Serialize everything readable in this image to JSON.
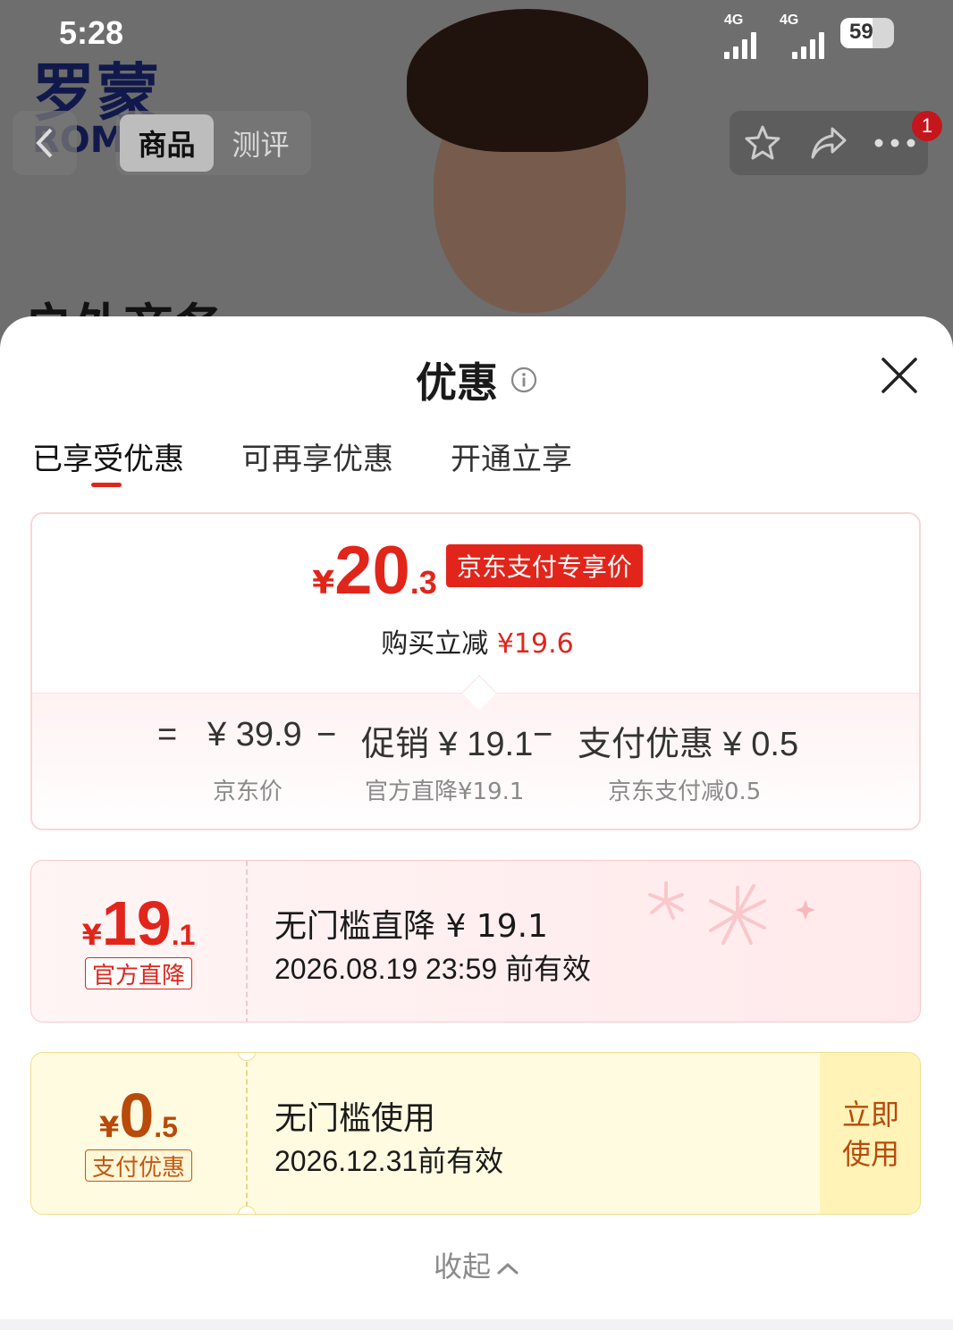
{
  "status": {
    "time": "5:28",
    "net1": "4G",
    "net2": "4G",
    "battery": "59"
  },
  "background": {
    "brand": "罗蒙",
    "brand_en": "ROM",
    "heading": "户外商务",
    "nav": {
      "tab_goods": "商品",
      "tab_review": "测评",
      "badge": "1"
    }
  },
  "sheet": {
    "title": "优惠",
    "tabs": [
      "已享受优惠",
      "可再享优惠",
      "开通立享"
    ],
    "summary": {
      "currency": "¥",
      "price_int": "20",
      "price_dec": ".3",
      "tag": "京东支付专享价",
      "reduce_label": "购买立减",
      "reduce_amount": "¥19.6",
      "formula": {
        "eq": "=",
        "base": "¥ 39.9",
        "minus1": "−",
        "promo": "促销 ¥ 19.1",
        "minus2": "−",
        "pay": "支付优惠 ¥ 0.5"
      },
      "labels": {
        "base": "京东价",
        "promo": "官方直降¥19.1",
        "pay": "京东支付减0.5"
      }
    },
    "coupons": [
      {
        "currency": "¥",
        "int": "19",
        "dec": ".1",
        "tag": "官方直降",
        "title": "无门槛直降 ¥ 19.1",
        "valid": "2026.08.19 23:59 前有效"
      },
      {
        "currency": "¥",
        "int": "0",
        "dec": ".5",
        "tag": "支付优惠",
        "title": "无门槛使用",
        "valid": "2026.12.31前有效",
        "action": "立即使用"
      }
    ],
    "collapse": "收起"
  },
  "colors": {
    "accent": "#e1251b",
    "gold": "#b84a0a"
  }
}
